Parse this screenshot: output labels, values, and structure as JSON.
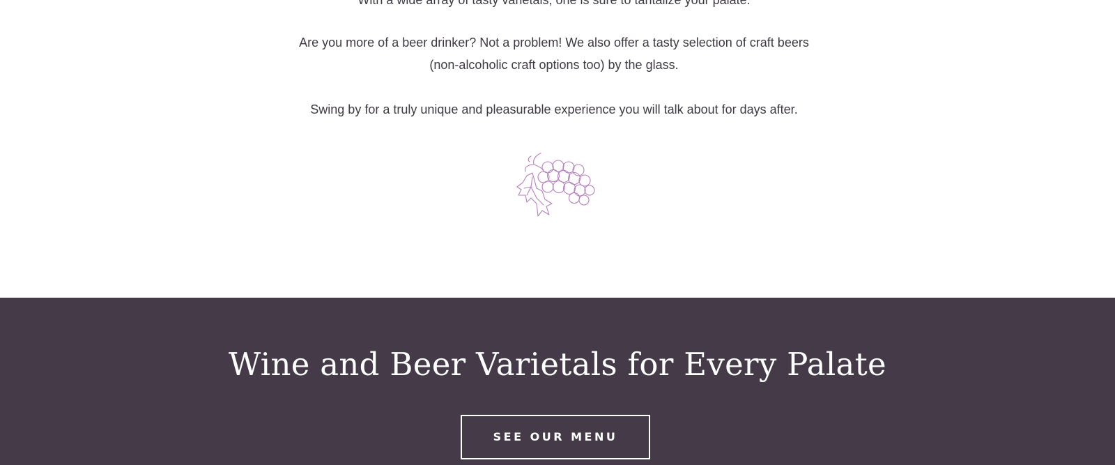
{
  "intro": {
    "paragraph_partial": "With a wide array of tasty varietals, one is sure to tantalize your palate.",
    "paragraph_beer": "Are you more of a beer drinker? Not a problem! We also offer a tasty selection of craft beers\n(non-alcoholic craft options too) by the glass.",
    "paragraph_visit": "Swing by for a truly unique and pleasurable experience you will talk about for days after.",
    "divider_icon": "grapes-icon",
    "icon_color": "#b57fbf"
  },
  "banner": {
    "title": "Wine and Beer Varietals for Every Palate",
    "button_label": "SEE OUR MENU",
    "background_color": "#443a48"
  }
}
